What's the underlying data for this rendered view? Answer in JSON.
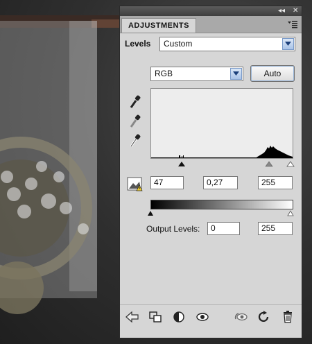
{
  "panel": {
    "tab_label": "ADJUSTMENTS",
    "collapse_glyph": "◂◂",
    "close_glyph": "✕"
  },
  "levels": {
    "label": "Levels",
    "preset_value": "Custom",
    "channel_value": "RGB",
    "auto_label": "Auto",
    "input_black": "47",
    "input_gamma": "0,27",
    "input_white": "255",
    "output_label": "Output Levels:",
    "output_black": "0",
    "output_white": "255"
  },
  "icons": {
    "eyedroppers": [
      "black-point-eyedropper-icon",
      "gray-point-eyedropper-icon",
      "white-point-eyedropper-icon"
    ],
    "warning": "histogram-warning-icon",
    "bottom": [
      "back-arrow-icon",
      "clip-to-layer-icon",
      "visibility-eye-icon",
      "view-previous-icon",
      "reset-icon",
      "delete-icon"
    ]
  },
  "colors": {
    "panel_bg": "#d6d6d6",
    "titlebar": "#4a4a4a",
    "accent_blue": "#a9c3e8"
  }
}
